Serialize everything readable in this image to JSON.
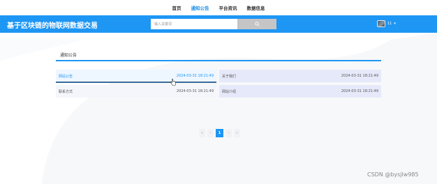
{
  "topnav": {
    "items": [
      {
        "label": "首页",
        "active": false
      },
      {
        "label": "通知公告",
        "active": true
      },
      {
        "label": "平台资讯",
        "active": false
      },
      {
        "label": "数据信息",
        "active": false
      }
    ]
  },
  "header": {
    "title": "基于区块链的物联网数据交易",
    "search_placeholder": "输入关键词",
    "user_name": "11",
    "search_icon": "search-icon",
    "chevron_icon": "chevron-down-icon",
    "accent_color": "#1e96f4"
  },
  "main": {
    "section_title": "通知公告",
    "items": [
      {
        "label": "网站公告",
        "date": "2024-03-31 18:21:49"
      },
      {
        "label": "关于我们",
        "date": "2024-03-31 18:21:49"
      },
      {
        "label": "联系方式",
        "date": "2024-03-31 18:21:49"
      },
      {
        "label": "网站介绍",
        "date": "2024-03-31 18:21:49"
      }
    ]
  },
  "pagination": {
    "first": "«",
    "prev": "‹",
    "current": "1",
    "next": "›",
    "last": "»"
  },
  "watermark": "CSDN @bysjlw985"
}
